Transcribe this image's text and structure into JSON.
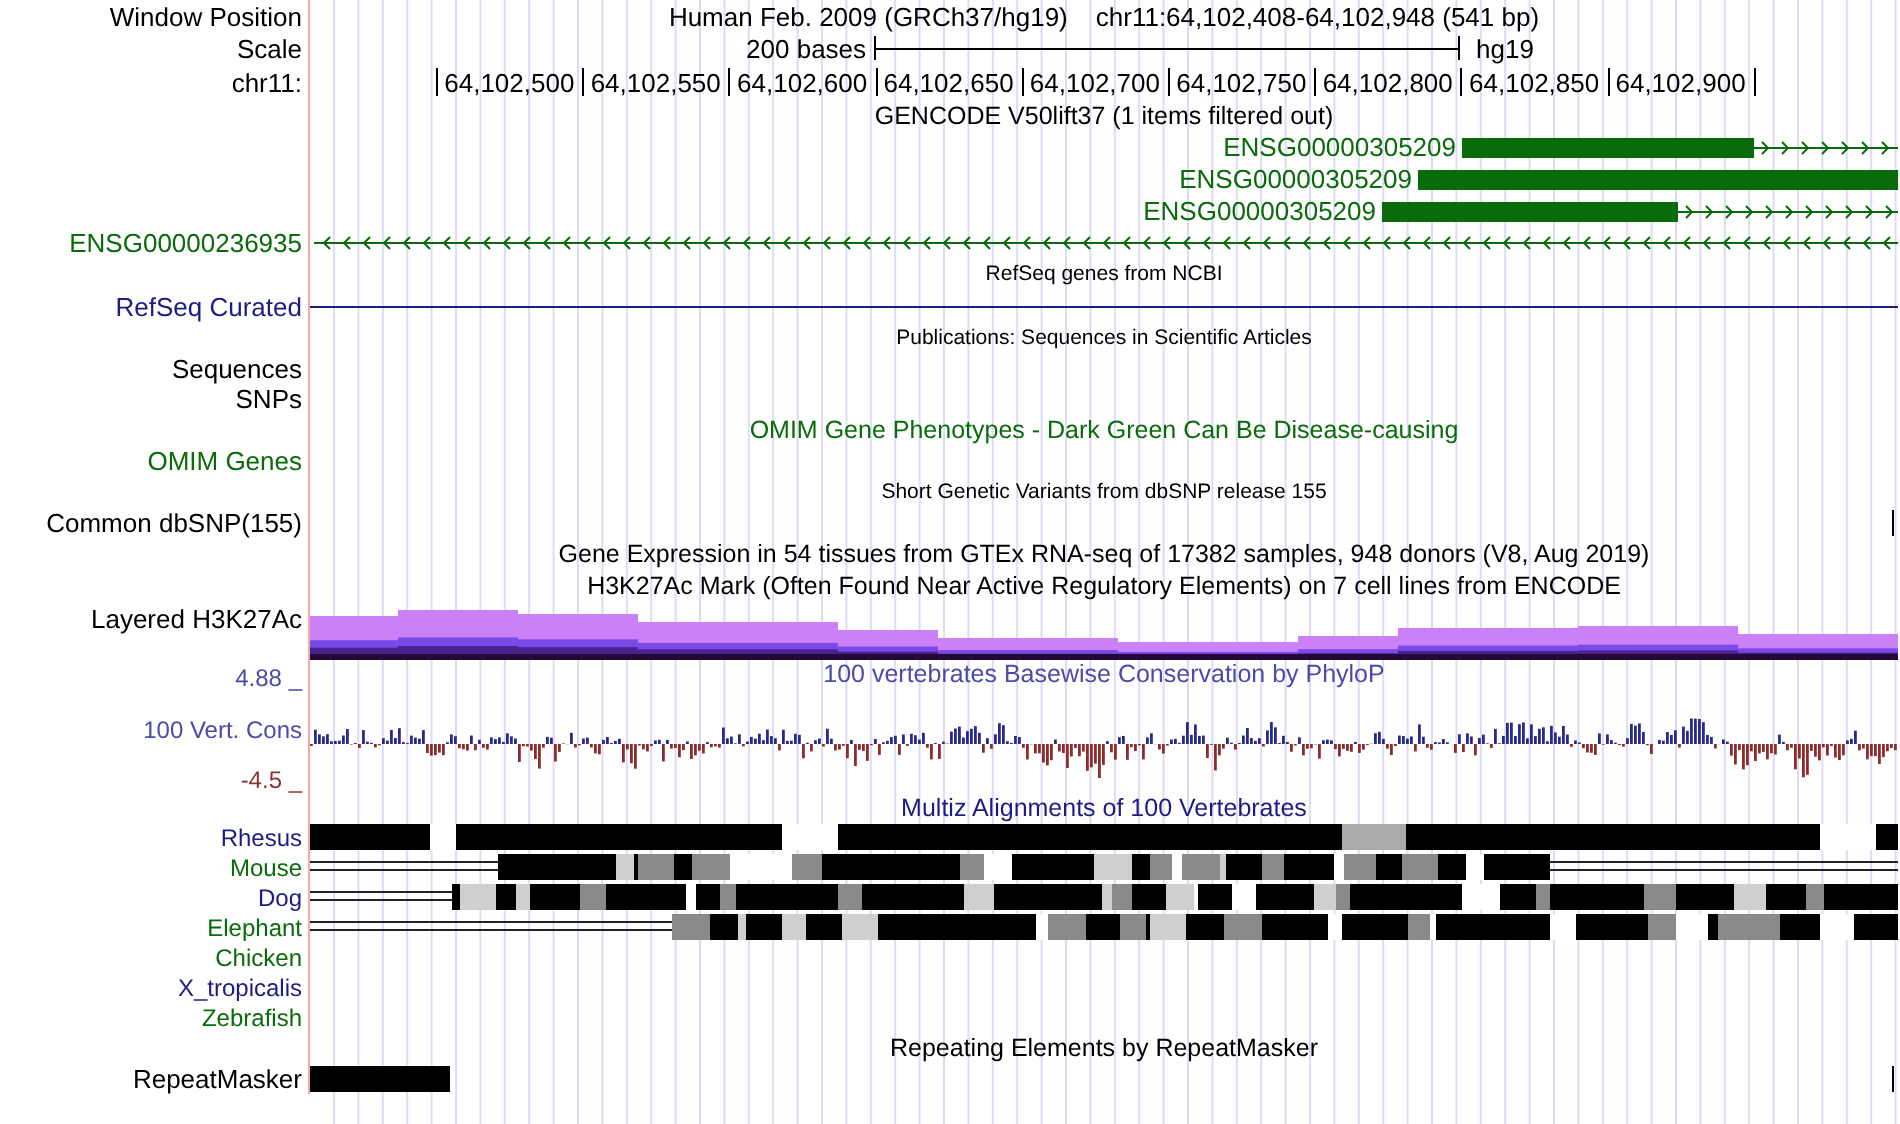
{
  "header": {
    "label": "Window Position",
    "assembly": "Human Feb. 2009 (GRCh37/hg19)",
    "position": "chr11:64,102,408-64,102,948 (541 bp)"
  },
  "scale": {
    "label": "Scale",
    "bar_text": "200 bases",
    "assembly": "hg19"
  },
  "ruler": {
    "label": "chr11:",
    "ticks": [
      "64,102,500",
      "64,102,550",
      "64,102,600",
      "64,102,650",
      "64,102,700",
      "64,102,750",
      "64,102,800",
      "64,102,850",
      "64,102,900"
    ]
  },
  "tracks": [
    {
      "kind": "genes",
      "title": "GENCODE V50lift37 (1 items filtered out)",
      "color": "#0a6b0a",
      "features": [
        {
          "name": "ENSG00000305209",
          "kind": "inline",
          "reverse": false
        },
        {
          "name": "ENSG00000305209",
          "kind": "inline",
          "reverse": false
        },
        {
          "name": "ENSG00000305209",
          "kind": "inline",
          "reverse": false
        },
        {
          "name": "ENSG00000236935",
          "kind": "margin",
          "reverse": true
        }
      ]
    },
    {
      "kind": "line",
      "title": "RefSeq genes from NCBI",
      "labels": [
        "RefSeq Curated"
      ],
      "color": "#1c1c84"
    },
    {
      "kind": "empty",
      "title": "Publications: Sequences in Scientific Articles",
      "labels": [
        "Sequences",
        "SNPs"
      ]
    },
    {
      "kind": "empty",
      "title": "OMIM Gene Phenotypes - Dark Green Can Be Disease-causing",
      "labels": [
        "OMIM Genes"
      ],
      "color": "#0a6b0a"
    },
    {
      "kind": "ticks",
      "title": "Short Genetic Variants from dbSNP release 155",
      "labels": [
        "Common dbSNP(155)"
      ]
    },
    {
      "kind": "empty",
      "title": "Gene Expression in 54 tissues from GTEx RNA-seq of 17382 samples, 948 donors (V8, Aug 2019)"
    },
    {
      "kind": "layered",
      "title": "H3K27Ac Mark (Often Found Near Active Regulatory Elements) on 7 cell lines from ENCODE",
      "labels": [
        "Layered H3K27Ac"
      ]
    },
    {
      "kind": "wiggle",
      "title": "100 vertebrates Basewise Conservation by PhyloP",
      "labels": [
        "100 Vert. Cons"
      ],
      "color": "#4b4ba8",
      "max": "4.88 _",
      "min": "-4.5 _"
    },
    {
      "kind": "alignment",
      "title": "Multiz Alignments of 100 Vertebrates",
      "color": "#1c1c84",
      "species": [
        {
          "name": "Rhesus",
          "color": "#1c1c84",
          "aligned": true
        },
        {
          "name": "Mouse",
          "color": "#0a6b0a",
          "aligned": true
        },
        {
          "name": "Dog",
          "color": "#1c1c84",
          "aligned": true
        },
        {
          "name": "Elephant",
          "color": "#0a6b0a",
          "aligned": true
        },
        {
          "name": "Chicken",
          "color": "#0a6b0a",
          "aligned": false
        },
        {
          "name": "X_tropicalis",
          "color": "#1c1c84",
          "aligned": false
        },
        {
          "name": "Zebrafish",
          "color": "#0a6b0a",
          "aligned": false
        }
      ]
    },
    {
      "kind": "blocks",
      "title": "Repeating Elements by RepeatMasker",
      "labels": [
        "RepeatMasker"
      ]
    }
  ]
}
